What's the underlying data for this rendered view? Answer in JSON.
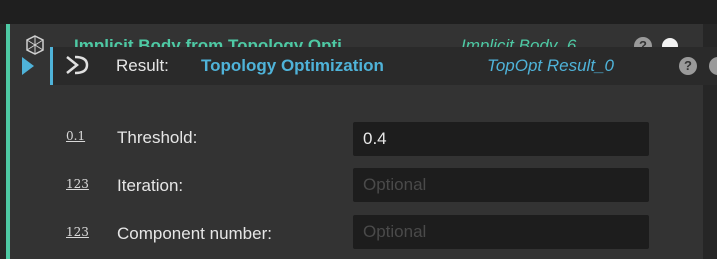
{
  "node": {
    "title": "Implicit Body from Topology Opti...",
    "subtitle": "Implicit Body_6",
    "help_label": "?",
    "accent_color": "#4ec9a4",
    "icon": "body-mesh-icon"
  },
  "input_result": {
    "label": "Result:",
    "value": "Topology Optimization",
    "subtitle": "TopOpt Result_0",
    "help_label": "?",
    "accent_color": "#4fb3d9",
    "icon": "topology-icon"
  },
  "fields": [
    {
      "type_icon": "0.1",
      "label": "Threshold:",
      "value": "0.4",
      "placeholder": ""
    },
    {
      "type_icon": "123",
      "label": "Iteration:",
      "value": "",
      "placeholder": "Optional"
    },
    {
      "type_icon": "123",
      "label": "Component number:",
      "value": "",
      "placeholder": "Optional"
    }
  ]
}
